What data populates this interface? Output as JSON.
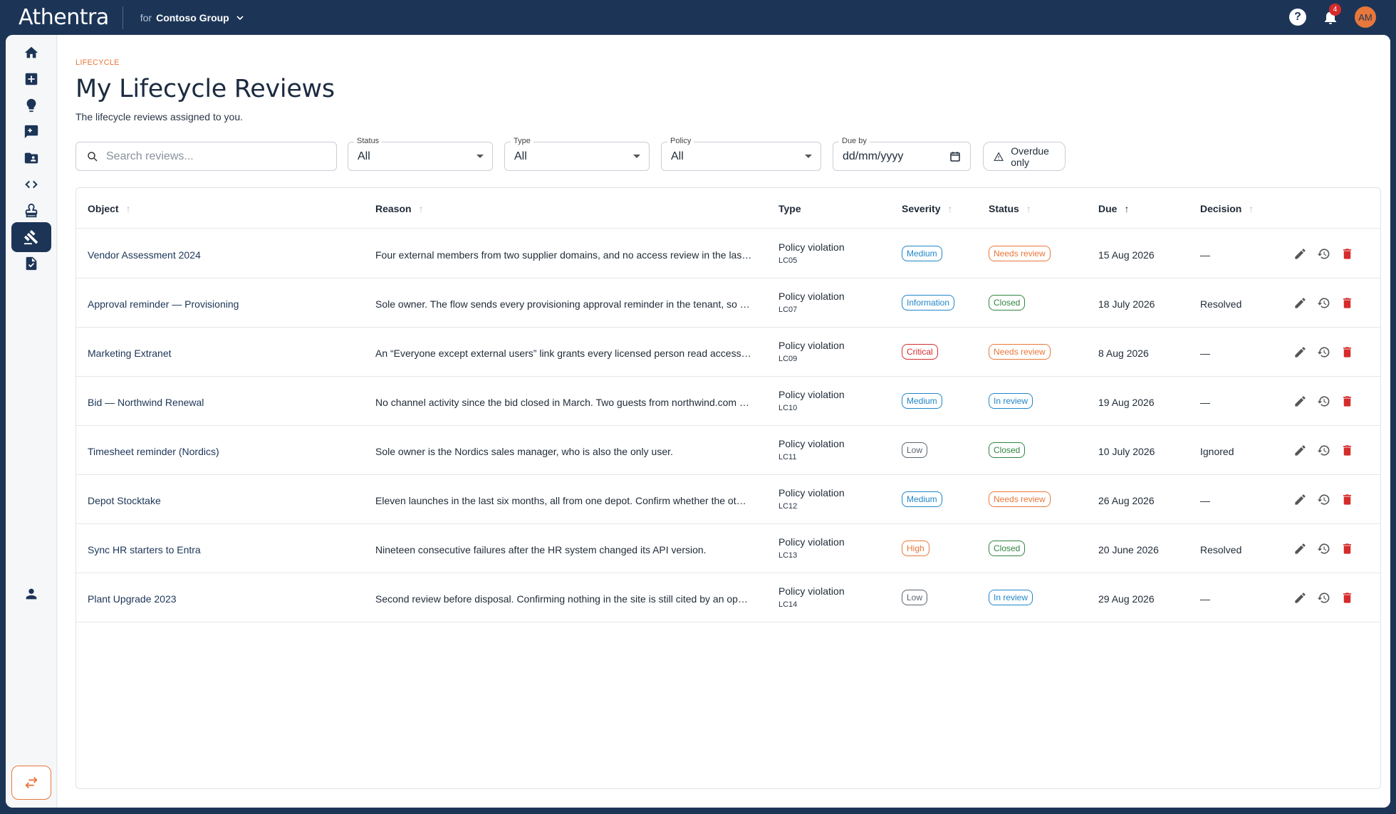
{
  "app": {
    "brand": "Athentra",
    "tenant_prefix": "for",
    "tenant_name": "Contoso Group",
    "notification_count": "4",
    "avatar_initials": "AM",
    "accent": "#e8773b",
    "navy": "#1c3557"
  },
  "sidebar": {
    "items": [
      {
        "icon": "home-icon"
      },
      {
        "icon": "add-box-icon"
      },
      {
        "icon": "lightbulb-icon"
      },
      {
        "icon": "feedback-icon"
      },
      {
        "icon": "folder-shared-icon"
      },
      {
        "icon": "code-icon"
      },
      {
        "icon": "stamp-icon"
      },
      {
        "icon": "gavel-icon",
        "active": true
      },
      {
        "icon": "task-document-icon"
      }
    ],
    "bottom": [
      {
        "icon": "person-icon"
      },
      {
        "icon": "swap-icon"
      }
    ]
  },
  "page": {
    "eyebrow": "LIFECYCLE",
    "title": "My Lifecycle Reviews",
    "subtitle": "The lifecycle reviews assigned to you."
  },
  "filters": {
    "search_placeholder": "Search reviews...",
    "status": {
      "label": "Status",
      "value": "All"
    },
    "type": {
      "label": "Type",
      "value": "All"
    },
    "policy": {
      "label": "Policy",
      "value": "All"
    },
    "due": {
      "label": "Due by",
      "value": "dd/mm/yyyy"
    },
    "overdue_label": "Overdue only"
  },
  "table": {
    "columns": {
      "object": "Object",
      "reason": "Reason",
      "type": "Type",
      "severity": "Severity",
      "status": "Status",
      "due": "Due",
      "decision": "Decision"
    },
    "rows": [
      {
        "object": "Vendor Assessment 2024",
        "reason": "Four external members from two supplier domains, and no access review in the las…",
        "type": "Policy violation",
        "code": "LC05",
        "severity": "Medium",
        "status": "Needs review",
        "due": "15 Aug 2026",
        "decision": "—"
      },
      {
        "object": "Approval reminder — Provisioning",
        "reason": "Sole owner. The flow sends every provisioning approval reminder in the tenant, so …",
        "type": "Policy violation",
        "code": "LC07",
        "severity": "Information",
        "status": "Closed",
        "due": "18 July 2026",
        "decision": "Resolved"
      },
      {
        "object": "Marketing Extranet",
        "reason": "An “Everyone except external users” link grants every licensed person read access t…",
        "type": "Policy violation",
        "code": "LC09",
        "severity": "Critical",
        "status": "Needs review",
        "due": "8 Aug 2026",
        "decision": "—"
      },
      {
        "object": "Bid — Northwind Renewal",
        "reason": "No channel activity since the bid closed in March. Two guests from northwind.com …",
        "type": "Policy violation",
        "code": "LC10",
        "severity": "Medium",
        "status": "In review",
        "due": "19 Aug 2026",
        "decision": "—"
      },
      {
        "object": "Timesheet reminder (Nordics)",
        "reason": "Sole owner is the Nordics sales manager, who is also the only user.",
        "type": "Policy violation",
        "code": "LC11",
        "severity": "Low",
        "status": "Closed",
        "due": "10 July 2026",
        "decision": "Ignored"
      },
      {
        "object": "Depot Stocktake",
        "reason": "Eleven launches in the last six months, all from one depot. Confirm whether the ot…",
        "type": "Policy violation",
        "code": "LC12",
        "severity": "Medium",
        "status": "Needs review",
        "due": "26 Aug 2026",
        "decision": "—"
      },
      {
        "object": "Sync HR starters to Entra",
        "reason": "Nineteen consecutive failures after the HR system changed its API version.",
        "type": "Policy violation",
        "code": "LC13",
        "severity": "High",
        "status": "Closed",
        "due": "20 June 2026",
        "decision": "Resolved"
      },
      {
        "object": "Plant Upgrade 2023",
        "reason": "Second review before disposal. Confirming nothing in the site is still cited by an op…",
        "type": "Policy violation",
        "code": "LC14",
        "severity": "Low",
        "status": "In review",
        "due": "29 Aug 2026",
        "decision": "—"
      }
    ],
    "severity_colors": {
      "Information": "#1f86c8",
      "Low": "#5b6470",
      "Medium": "#1f86c8",
      "High": "#e8773b",
      "Critical": "#d52b2b"
    },
    "status_colors": {
      "Needs review": "#e8773b",
      "In review": "#1f86c8",
      "Closed": "#2e8540"
    }
  }
}
